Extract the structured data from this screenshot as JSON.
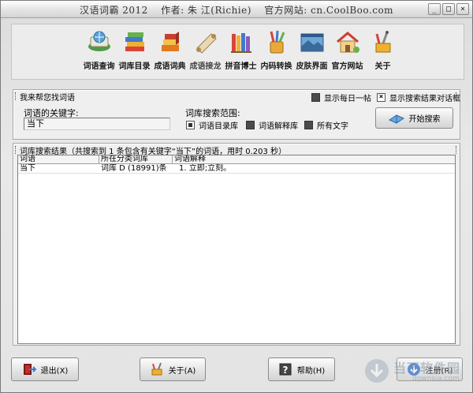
{
  "window": {
    "title": "汉语词霸 2012",
    "author": "作者: 朱 江(Richie)",
    "website": "官方网站: cn.CoolBoo.com",
    "buttons": [
      "_",
      "□",
      "×"
    ]
  },
  "toolbar": {
    "items": [
      {
        "label": "词语查询",
        "icon": "book-globe-icon"
      },
      {
        "label": "词库目录",
        "icon": "stacked-books-icon"
      },
      {
        "label": "成语词典",
        "icon": "dictionary-icon"
      },
      {
        "label": "成语接龙",
        "icon": "scroll-icon"
      },
      {
        "label": "拼音博士",
        "icon": "bookshelf-icon"
      },
      {
        "label": "内码转换",
        "icon": "pencil-cup-icon"
      },
      {
        "label": "皮肤界面",
        "icon": "landscape-icon"
      },
      {
        "label": "官方网站",
        "icon": "house-icon"
      },
      {
        "label": "关于",
        "icon": "tools-icon"
      }
    ]
  },
  "search": {
    "header": "我来帮您找词语",
    "keyword_label": "词语的关键字:",
    "keyword_value": "当下",
    "scope_label": "词库搜索范围:",
    "scopes": [
      {
        "label": "词语目录库",
        "selected": true
      },
      {
        "label": "词语解释库",
        "selected": false
      },
      {
        "label": "所有文字",
        "selected": false
      }
    ],
    "show_daily_label": "显示每日一帖",
    "show_daily_checked": false,
    "show_dialog_label": "显示搜索结果对话框",
    "show_dialog_checked": true,
    "search_button": "开始搜索"
  },
  "results": {
    "header": "词库搜索结果（共搜索到 1 条包含有关键字“当下”的词语，用时 0.203 秒）",
    "columns": [
      "词语",
      "所在分类词库",
      "词语解释"
    ],
    "rows": [
      [
        "当下",
        "词库 D (18991)条",
        "1. 立即;立刻。"
      ]
    ]
  },
  "footer": {
    "exit": "退出(X)",
    "about": "关于(A)",
    "help": "帮助(H)",
    "register": "注册(R)",
    "watermark": "当下软件园",
    "watermark_url": "downxia.com"
  },
  "colors": {
    "accent": "#3d7bd1",
    "exit_red": "#c0302a",
    "window_bg": "#e8e8e8"
  }
}
